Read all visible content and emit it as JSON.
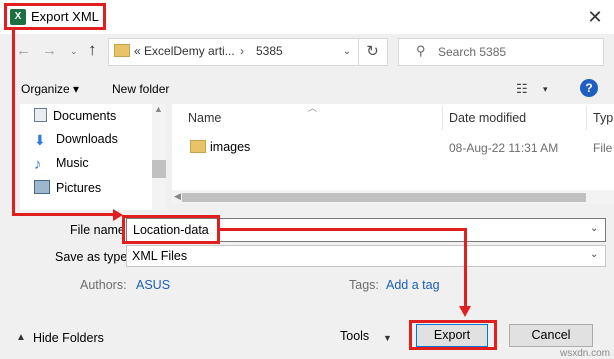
{
  "window": {
    "title": "Export XML",
    "app_icon": "excel-icon",
    "close_glyph": "✕"
  },
  "nav_glyphs": {
    "back": "←",
    "forward": "→",
    "recent": "⌄",
    "up": "↑"
  },
  "address": {
    "path_prefix": "«",
    "segment1": "ExcelDemy arti...",
    "separator": "›",
    "segment2": "5385",
    "refresh": "↻"
  },
  "search": {
    "placeholder": "Search 5385"
  },
  "toolbar": {
    "organize": "Organize ▾",
    "new_folder": "New folder",
    "view_icon": "☷",
    "view_drop": "▾",
    "help": "?"
  },
  "sidebar": {
    "items": [
      {
        "label": "Documents",
        "icon": "documents-icon",
        "color": "#6b7c93"
      },
      {
        "label": "Downloads",
        "icon": "downloads-icon",
        "color": "#2f7bd6"
      },
      {
        "label": "Music",
        "icon": "music-icon",
        "color": "#2f7bd6"
      },
      {
        "label": "Pictures",
        "icon": "pictures-icon",
        "color": "#4a6a8c"
      }
    ]
  },
  "file_list": {
    "columns": [
      "Name",
      "Date modified",
      "Typ"
    ],
    "rows": [
      {
        "name": "images",
        "date": "08-Aug-22 11:31 AM",
        "type": "File"
      }
    ]
  },
  "form": {
    "file_name_label": "File name:",
    "file_name_value": "Location-data",
    "save_as_label": "Save as type:",
    "save_as_value": "XML Files",
    "authors_label": "Authors:",
    "authors_value": "ASUS",
    "tags_label": "Tags:",
    "tags_value": "Add a tag"
  },
  "footer": {
    "hide_folders": "Hide Folders",
    "tools": "Tools",
    "export": "Export",
    "cancel": "Cancel"
  },
  "watermark": "wsxdn.com",
  "colors": {
    "annotation": "#e21f1f",
    "link": "#1a5fb4",
    "excel_green": "#1d6f42"
  }
}
